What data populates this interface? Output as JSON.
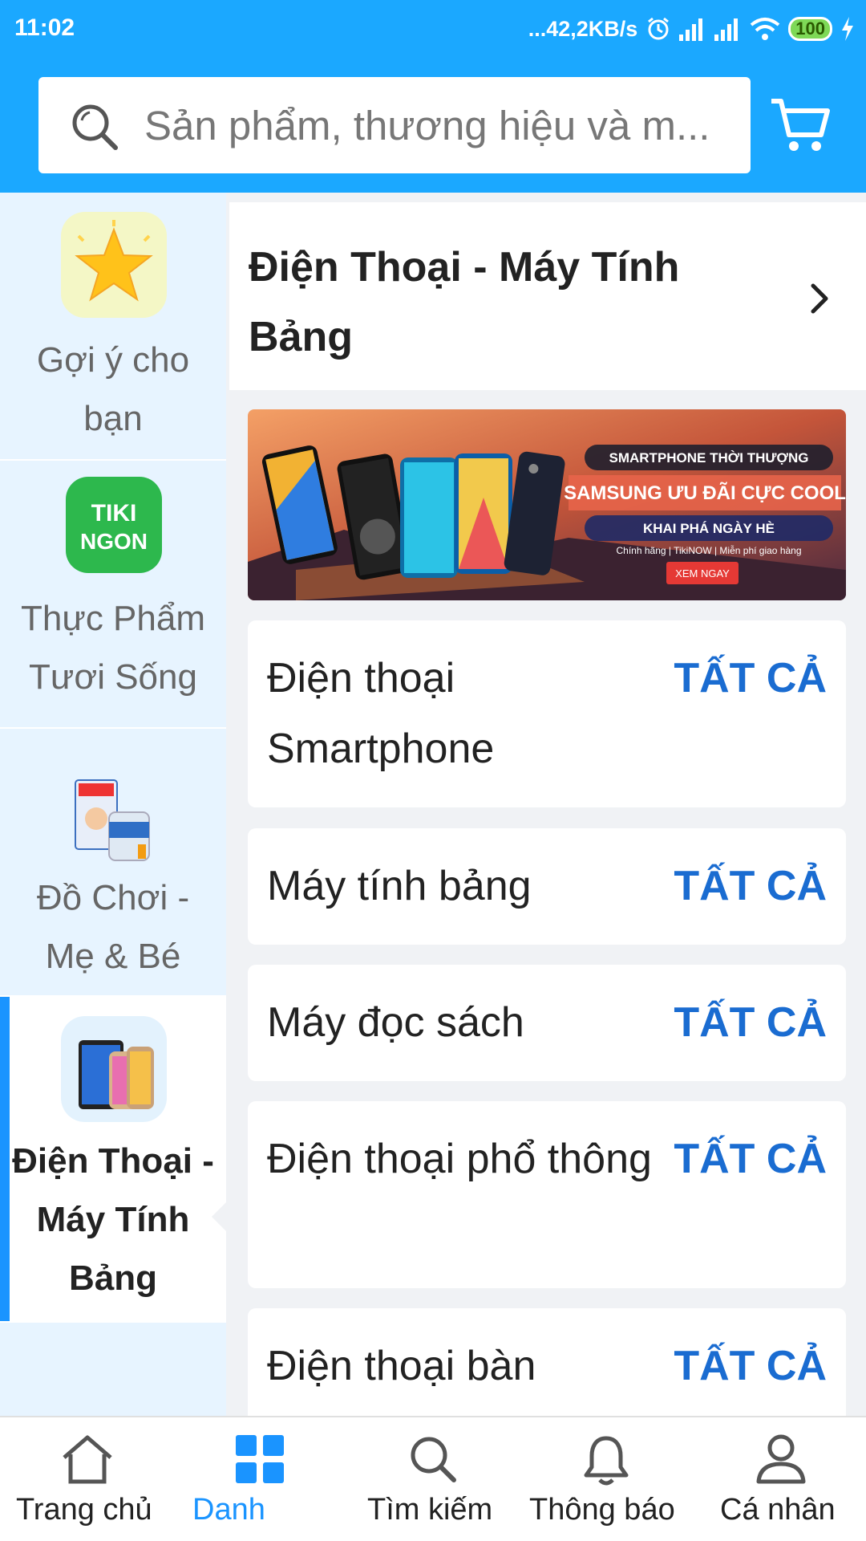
{
  "status_bar": {
    "time": "11:02",
    "network_speed": "...42,2KB/s",
    "battery": "100",
    "icons": [
      "alarm-icon",
      "signal-icon",
      "signal-icon",
      "wifi-icon",
      "battery-icon",
      "charging-icon"
    ]
  },
  "search": {
    "placeholder": "Sản phẩm, thương hiệu và m..."
  },
  "colors": {
    "header": "#1ba8ff",
    "accent": "#1a94ff",
    "link": "#1a6cd1",
    "sidebar_bg": "#e7f4ff"
  },
  "sidebar": {
    "items": [
      {
        "label": "Gợi ý cho bạn",
        "icon": "star-icon",
        "active": false
      },
      {
        "label": "Thực Phẩm Tươi Sống",
        "icon": "tiki-ngon-logo",
        "logo_text": "TIKI NGON",
        "active": false
      },
      {
        "label": "Đồ Chơi - Mẹ & Bé",
        "icon": "baby-products-icon",
        "active": false
      },
      {
        "label": "Điện Thoại - Máy Tính Bảng",
        "icon": "phones-icon",
        "active": true
      }
    ]
  },
  "main": {
    "title": "Điện Thoại - Máy Tính Bảng",
    "banner": {
      "line1": "SMARTPHONE THỜI THƯỢNG",
      "line2": "SAMSUNG ƯU ĐÃI CỰC COOL",
      "line3": "KHAI PHÁ NGÀY HÈ",
      "line4": "Chính hãng | TikiNOW | Miễn phí giao hàng",
      "cta": "XEM NGAY"
    },
    "categories": [
      {
        "name": "Điện thoại Smartphone",
        "action": "TẤT CẢ"
      },
      {
        "name": "Máy tính bảng",
        "action": "TẤT CẢ"
      },
      {
        "name": "Máy đọc sách",
        "action": "TẤT CẢ"
      },
      {
        "name": "Điện thoại phổ thông",
        "action": "TẤT CẢ"
      },
      {
        "name": "Điện thoại bàn",
        "action": "TẤT CẢ"
      }
    ]
  },
  "bottom_nav": [
    {
      "label": "Trang chủ",
      "icon": "home-icon",
      "active": false
    },
    {
      "label": "Danh",
      "icon": "grid-icon",
      "active": true
    },
    {
      "label": "Tìm kiếm",
      "icon": "search-icon",
      "active": false
    },
    {
      "label": "Thông báo",
      "icon": "bell-icon",
      "active": false
    },
    {
      "label": "Cá nhân",
      "icon": "user-icon",
      "active": false
    }
  ]
}
